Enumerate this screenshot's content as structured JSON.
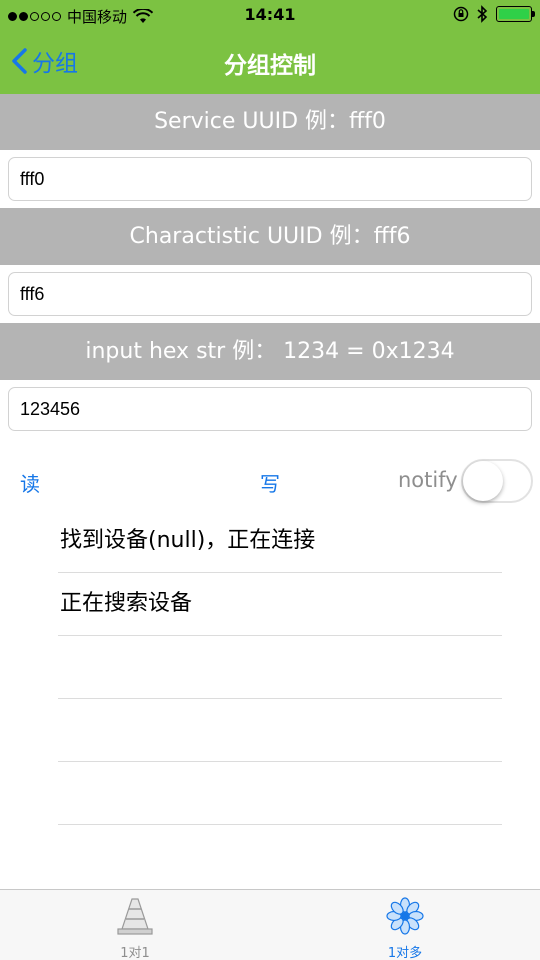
{
  "status_bar": {
    "carrier": "中国移动",
    "time": "14:41"
  },
  "nav": {
    "back_label": "分组",
    "title": "分组控制"
  },
  "service": {
    "header": "Service UUID 例：fff0",
    "value": "fff0"
  },
  "characteristic": {
    "header": "Charactistic UUID 例：fff6",
    "value": "fff6"
  },
  "hex_input": {
    "header": "input hex str 例：  1234 = 0x1234",
    "value": "123456"
  },
  "actions": {
    "read_label": "读",
    "write_label": "写",
    "notify_label": "notify",
    "notify_on": false
  },
  "log": {
    "items": [
      "找到设备(null)，正在连接",
      "正在搜索设备",
      "",
      "",
      ""
    ]
  },
  "tabs": [
    {
      "label": "1对1",
      "icon": "traffic-cone-icon",
      "selected": false
    },
    {
      "label": "1对多",
      "icon": "flower-icon",
      "selected": true
    }
  ],
  "colors": {
    "nav_green": "#7cc242",
    "link_blue": "#1677e8",
    "header_gray": "#b4b4b4",
    "tab_inactive": "#8e8e8e"
  }
}
